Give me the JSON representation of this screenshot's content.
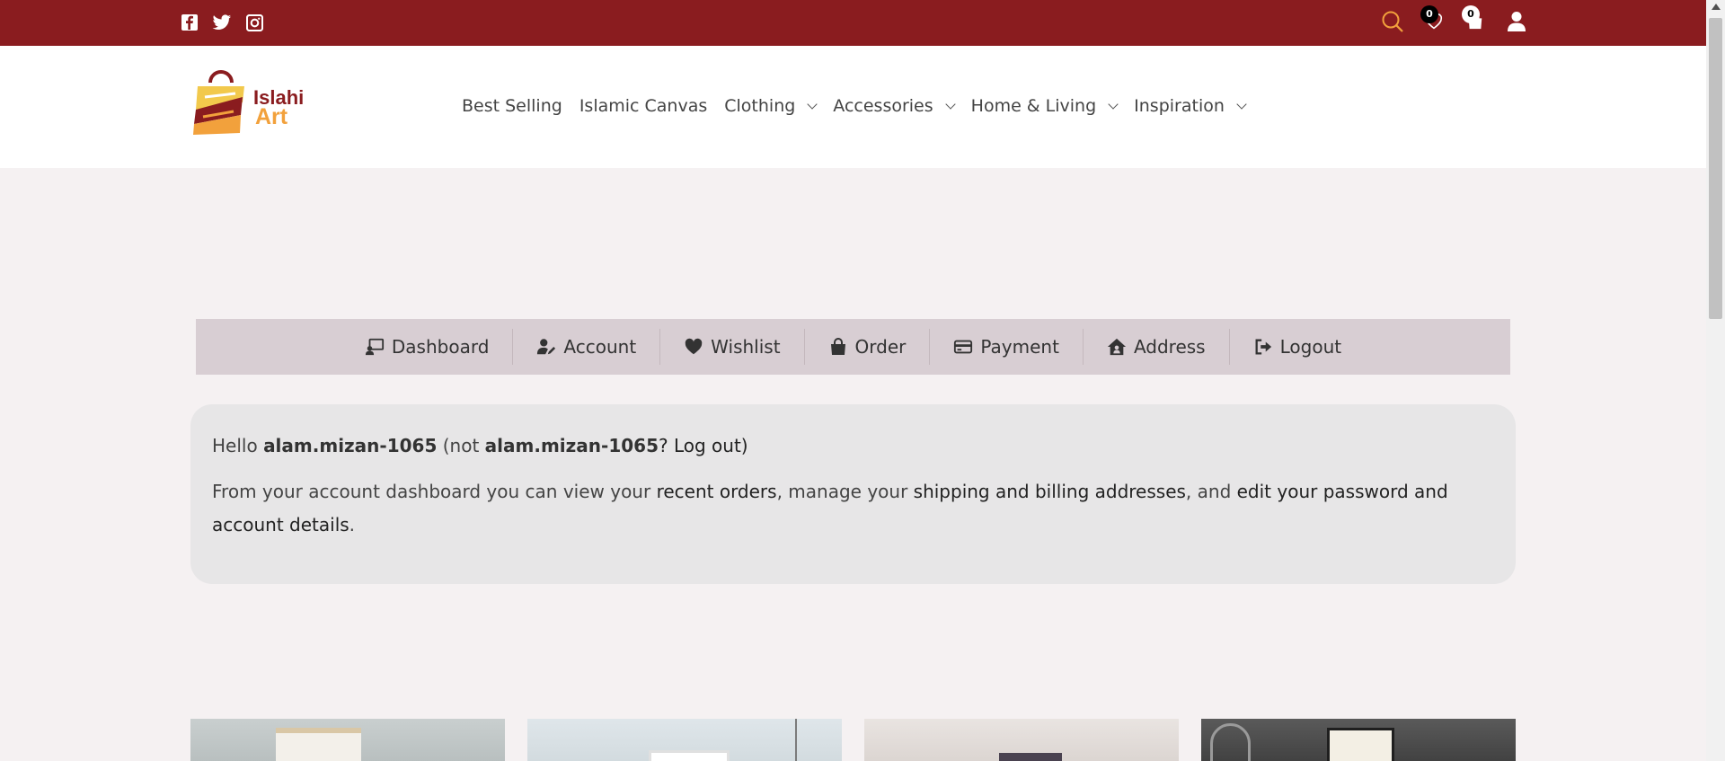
{
  "topbar": {
    "social": [
      "facebook-icon",
      "twitter-icon",
      "instagram-icon"
    ],
    "wishlist_count": "0",
    "cart_count": "0"
  },
  "brand": {
    "line1": "Islahi",
    "line2": "Art"
  },
  "nav": {
    "items": [
      {
        "label": "Best Selling",
        "dropdown": false
      },
      {
        "label": "Islamic Canvas",
        "dropdown": false
      },
      {
        "label": "Clothing",
        "dropdown": true
      },
      {
        "label": "Accessories",
        "dropdown": true
      },
      {
        "label": "Home & Living",
        "dropdown": true
      },
      {
        "label": "Inspiration",
        "dropdown": true
      }
    ]
  },
  "account_nav": {
    "tabs": [
      {
        "label": "Dashboard",
        "icon": "dashboard-icon"
      },
      {
        "label": "Account",
        "icon": "user-edit-icon"
      },
      {
        "label": "Wishlist",
        "icon": "heart-icon"
      },
      {
        "label": "Order",
        "icon": "bag-icon"
      },
      {
        "label": "Payment",
        "icon": "credit-card-icon"
      },
      {
        "label": "Address",
        "icon": "home-icon"
      },
      {
        "label": "Logout",
        "icon": "logout-icon"
      }
    ]
  },
  "dashboard": {
    "hello": "Hello",
    "username": "alam.mizan-1065",
    "not_prefix": "(not",
    "not_username": "alam.mizan-1065",
    "logout_question": "? Log out)",
    "intro_text": "From your account dashboard you can view your",
    "recent_orders": "recent orders",
    "manage_text": ", manage your",
    "addresses": "shipping and billing addresses",
    "and_text": ", and",
    "edit_details": "edit your password and account details",
    "end": "."
  },
  "colors": {
    "topbar": "#8a1c1f",
    "accent": "#f2a13c",
    "account_nav_bg": "#d8ced3",
    "content_bg": "#e7e6e7",
    "page_bg": "#f5f1f2"
  }
}
